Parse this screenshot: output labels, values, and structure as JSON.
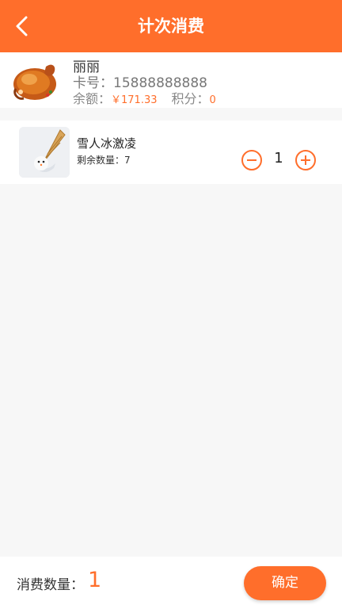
{
  "header": {
    "title": "计次消费",
    "back_icon": "chevron-left-icon"
  },
  "member": {
    "name": "丽丽",
    "card_label": "卡号：",
    "card_number": "15888888888",
    "balance_label": "余额：",
    "balance_value": "￥171.33",
    "points_label": "积分：",
    "points_value": "0"
  },
  "items": [
    {
      "name": "雪人冰激凌",
      "remaining_label": "剩余数量：",
      "remaining_value": "7",
      "quantity": "1",
      "minus_icon": "minus-circle-icon",
      "plus_icon": "plus-circle-icon"
    }
  ],
  "footer": {
    "count_label": "消费数量：",
    "count_value": "1",
    "confirm_label": "确定"
  },
  "colors": {
    "accent": "#ff6e2b",
    "background": "#f7f7f7"
  }
}
